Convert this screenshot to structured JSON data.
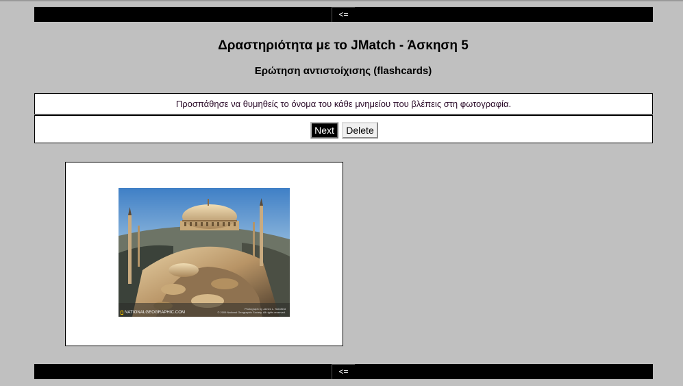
{
  "nav": {
    "back_label": "<="
  },
  "header": {
    "title": "Δραστηριότητα με το JMatch - Άσκηση 5",
    "subtitle": "Ερώτηση αντιστοίχισης (flashcards)"
  },
  "instructions": {
    "text": "Προσπάθησε να θυμηθείς το όνομα του κάθε μνημείου που βλέπεις στη φωτογραφία."
  },
  "controls": {
    "next_label": "Next",
    "delete_label": "Delete"
  },
  "card": {
    "logo_text": "NATIONALGEOGRAPHIC.COM",
    "credit_line1": "Photograph by James L. Stanfield",
    "credit_line2": "© 2009 National Geographic Society. All rights reserved."
  },
  "colors": {
    "page_bg": "#c0c0c0",
    "bar_bg": "#000000",
    "panel_bg": "#ffffff"
  },
  "icons": {
    "logo": "national-geographic-logo"
  }
}
